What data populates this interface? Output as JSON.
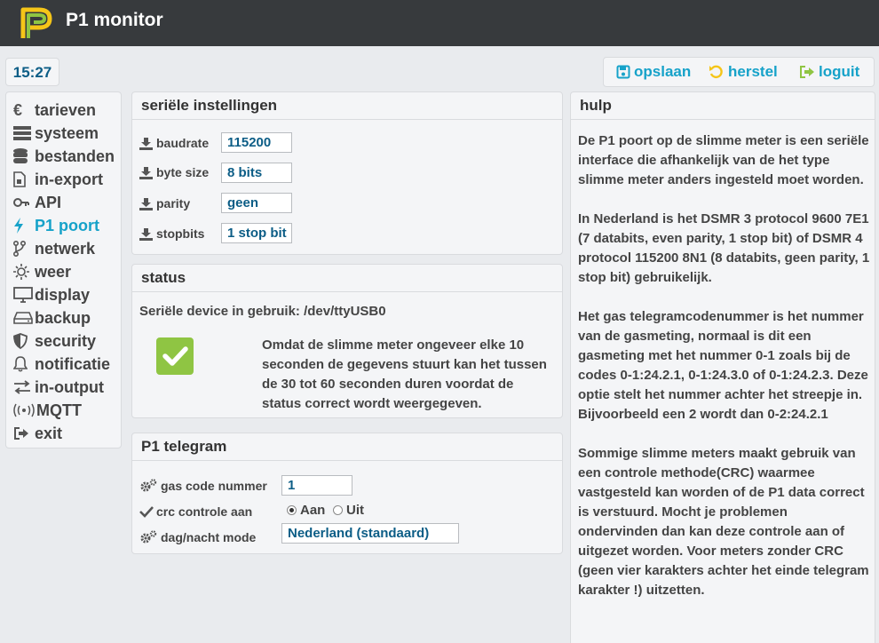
{
  "app": {
    "title": "P1 monitor",
    "logo_icon": "p1-logo",
    "accent": "#16a2c9",
    "header_bg": "#373a3d"
  },
  "clock": "15:27",
  "actions": [
    {
      "label": "opslaan",
      "icon": "save-icon"
    },
    {
      "label": "herstel",
      "icon": "undo-icon"
    },
    {
      "label": "loguit",
      "icon": "logout-icon"
    }
  ],
  "sidebar": {
    "items": [
      {
        "label": "tarieven",
        "icon": "euro-icon",
        "active": false
      },
      {
        "label": "systeem",
        "icon": "server-icon",
        "active": false
      },
      {
        "label": "bestanden",
        "icon": "database-icon",
        "active": false
      },
      {
        "label": "in-export",
        "icon": "file-icon",
        "active": false
      },
      {
        "label": "API",
        "icon": "key-icon",
        "active": false
      },
      {
        "label": "P1 poort",
        "icon": "bolt-icon",
        "active": true
      },
      {
        "label": "netwerk",
        "icon": "network-icon",
        "active": false
      },
      {
        "label": "weer",
        "icon": "sun-icon",
        "active": false
      },
      {
        "label": "display",
        "icon": "monitor-icon",
        "active": false
      },
      {
        "label": "backup",
        "icon": "hdd-icon",
        "active": false
      },
      {
        "label": "security",
        "icon": "shield-icon",
        "active": false
      },
      {
        "label": "notificatie",
        "icon": "bell-icon",
        "active": false
      },
      {
        "label": "in-output",
        "icon": "arrows-icon",
        "active": false
      },
      {
        "label": "MQTT",
        "icon": "broadcast-icon",
        "active": false
      },
      {
        "label": "exit",
        "icon": "exit-icon",
        "active": false
      }
    ]
  },
  "serial": {
    "title": "seriële instellingen",
    "fields": [
      {
        "label": "baudrate",
        "value": "115200"
      },
      {
        "label": "byte size",
        "value": "8 bits"
      },
      {
        "label": "parity",
        "value": "geen"
      },
      {
        "label": "stopbits",
        "value": "1 stop bit"
      }
    ]
  },
  "status": {
    "title": "status",
    "device_line": "Seriële device in gebruik: /dev/ttyUSB0",
    "ok": true,
    "note": "Omdat de slimme meter ongeveer elke 10 seconden de gegevens stuurt kan het tussen de 30 tot 60 seconden duren voordat de status correct wordt weergegeven."
  },
  "telegram": {
    "title": "P1 telegram",
    "gas_label": "gas code nummer",
    "gas_value": "1",
    "crc_label": "crc controle aan",
    "crc_on": "Aan",
    "crc_off": "Uit",
    "crc_selected": "Aan",
    "daynight_label": "dag/nacht mode",
    "daynight_value": "Nederland (standaard)"
  },
  "help": {
    "title": "hulp",
    "paragraphs": [
      "De P1 poort op de slimme meter is een seriële interface die afhankelijk van de het type slimme meter anders ingesteld moet worden.",
      "In Nederland is het DSMR 3 protocol 9600 7E1 (7 databits, even parity, 1 stop bit) of DSMR 4 protocol 115200 8N1 (8 databits, geen parity, 1 stop bit) gebruikelijk.",
      "Het gas telegramcodenummer is het nummer van de gasmeting, normaal is dit een gasmeting met het nummer 0-1 zoals bij de codes 0-1:24.2.1, 0-1:24.3.0 of 0-1:24.2.3. Deze optie stelt het nummer achter het streepje in. Bijvoorbeeld een 2 wordt dan 0-2:24.2.1",
      "Sommige slimme meters maakt gebruik van een controle methode(CRC) waarmee vastgesteld kan worden of de P1 data correct is verstuurd. Mocht je problemen ondervinden dan kan deze controle aan of uitgezet worden. Voor meters zonder CRC (geen vier karakters achter het einde telegram karakter !) uitzetten."
    ]
  }
}
